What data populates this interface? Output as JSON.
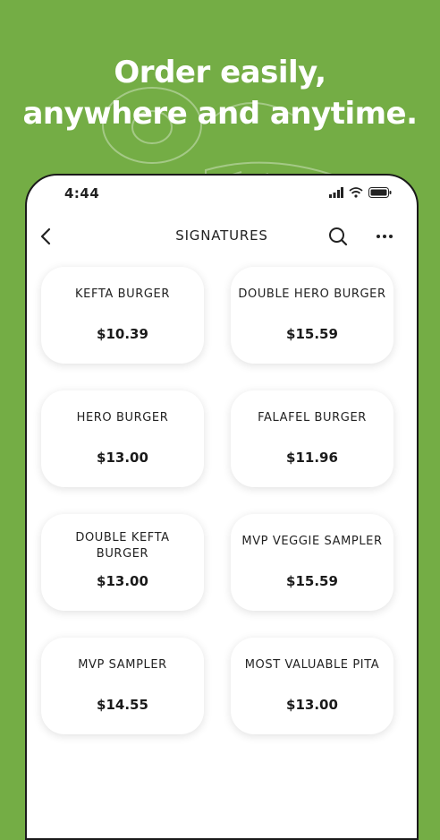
{
  "headline": {
    "line1": "Order easily,",
    "line2": "anywhere and anytime."
  },
  "status_bar": {
    "time": "4:44",
    "icons": [
      "signal-icon",
      "wifi-icon",
      "battery-icon"
    ]
  },
  "nav": {
    "title": "SIGNATURES",
    "icons": [
      "back-chevron-icon",
      "search-icon",
      "more-icon"
    ]
  },
  "items": [
    {
      "name": "KEFTA BURGER",
      "price": "$10.39"
    },
    {
      "name": "DOUBLE HERO BURGER",
      "price": "$15.59"
    },
    {
      "name": "HERO BURGER",
      "price": "$13.00"
    },
    {
      "name": "FALAFEL BURGER",
      "price": "$11.96"
    },
    {
      "name": "DOUBLE KEFTA BURGER",
      "price": "$13.00"
    },
    {
      "name": "MVP VEGGIE SAMPLER",
      "price": "$15.59"
    },
    {
      "name": "MVP SAMPLER",
      "price": "$14.55"
    },
    {
      "name": "MOST VALUABLE PITA",
      "price": "$13.00"
    }
  ],
  "colors": {
    "background": "#74ad45",
    "card": "#ffffff",
    "text": "#222222"
  }
}
